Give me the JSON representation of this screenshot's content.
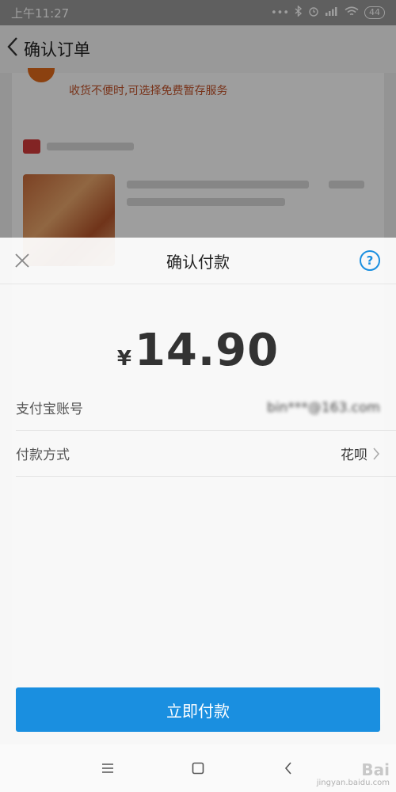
{
  "status_bar": {
    "time": "上午11:27",
    "battery": "44"
  },
  "order_page": {
    "title": "确认订单",
    "notice": "收货不便时,可选择免费暂存服务"
  },
  "payment_sheet": {
    "title": "确认付款",
    "currency_symbol": "¥",
    "amount": "14.90",
    "account_label": "支付宝账号",
    "account_value": "bin***@163.com",
    "method_label": "付款方式",
    "method_value": "花呗",
    "pay_button": "立即付款"
  },
  "watermark": {
    "line1": "Bai",
    "line2": "jingyan.baidu.com"
  },
  "colors": {
    "accent": "#1a8fe0",
    "notice": "#c2532a"
  }
}
